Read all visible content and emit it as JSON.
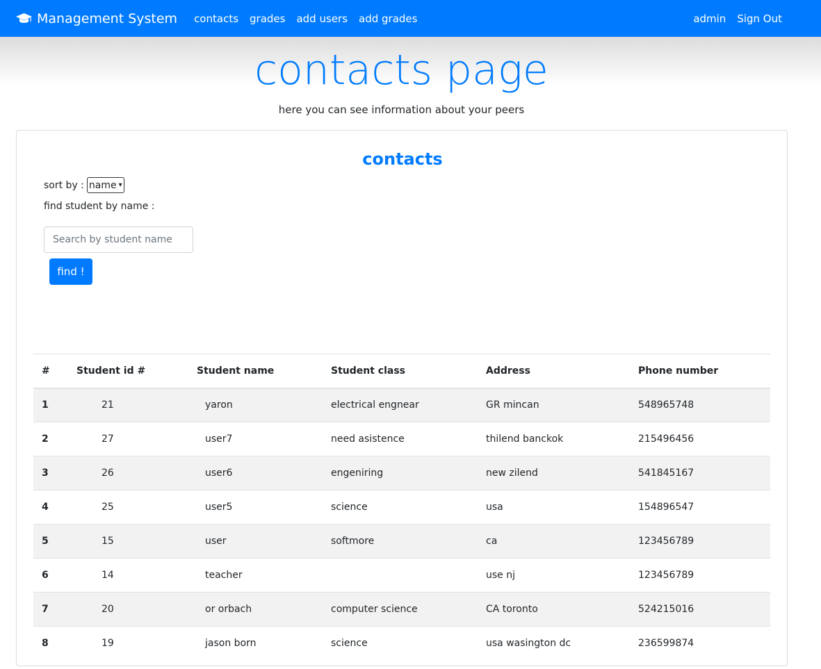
{
  "navbar": {
    "brand": "Management System",
    "brand_icon": "graduation-cap-icon",
    "links": [
      "contacts",
      "grades",
      "add users",
      "add grades"
    ],
    "user": "admin",
    "sign_out": "Sign Out",
    "color": "#007bff"
  },
  "hero": {
    "title": "contacts page",
    "subtitle": "here you can see information about your peers"
  },
  "card": {
    "title": "contacts",
    "sort_label": "sort by :",
    "sort_value": "name",
    "find_label": "find student by name :",
    "search_placeholder": "Search by student name",
    "find_button": "find !"
  },
  "table": {
    "headers": [
      "#",
      "Student id #",
      "Student name",
      "Student class",
      "Address",
      "Phone number"
    ],
    "rows": [
      [
        "1",
        "21",
        "yaron",
        "electrical engnear",
        "GR mincan",
        "548965748"
      ],
      [
        "2",
        "27",
        "user7",
        "need asistence",
        "thilend banckok",
        "215496456"
      ],
      [
        "3",
        "26",
        "user6",
        "engeniring",
        "new zilend",
        "541845167"
      ],
      [
        "4",
        "25",
        "user5",
        "science",
        "usa",
        "154896547"
      ],
      [
        "5",
        "15",
        "user",
        "softmore",
        "ca",
        "123456789"
      ],
      [
        "6",
        "14",
        "teacher",
        "",
        "use nj",
        "123456789"
      ],
      [
        "7",
        "20",
        "or orbach",
        "computer science",
        "CA toronto",
        "524215016"
      ],
      [
        "8",
        "19",
        "jason born",
        "science",
        "usa wasington dc",
        "236599874"
      ]
    ]
  }
}
